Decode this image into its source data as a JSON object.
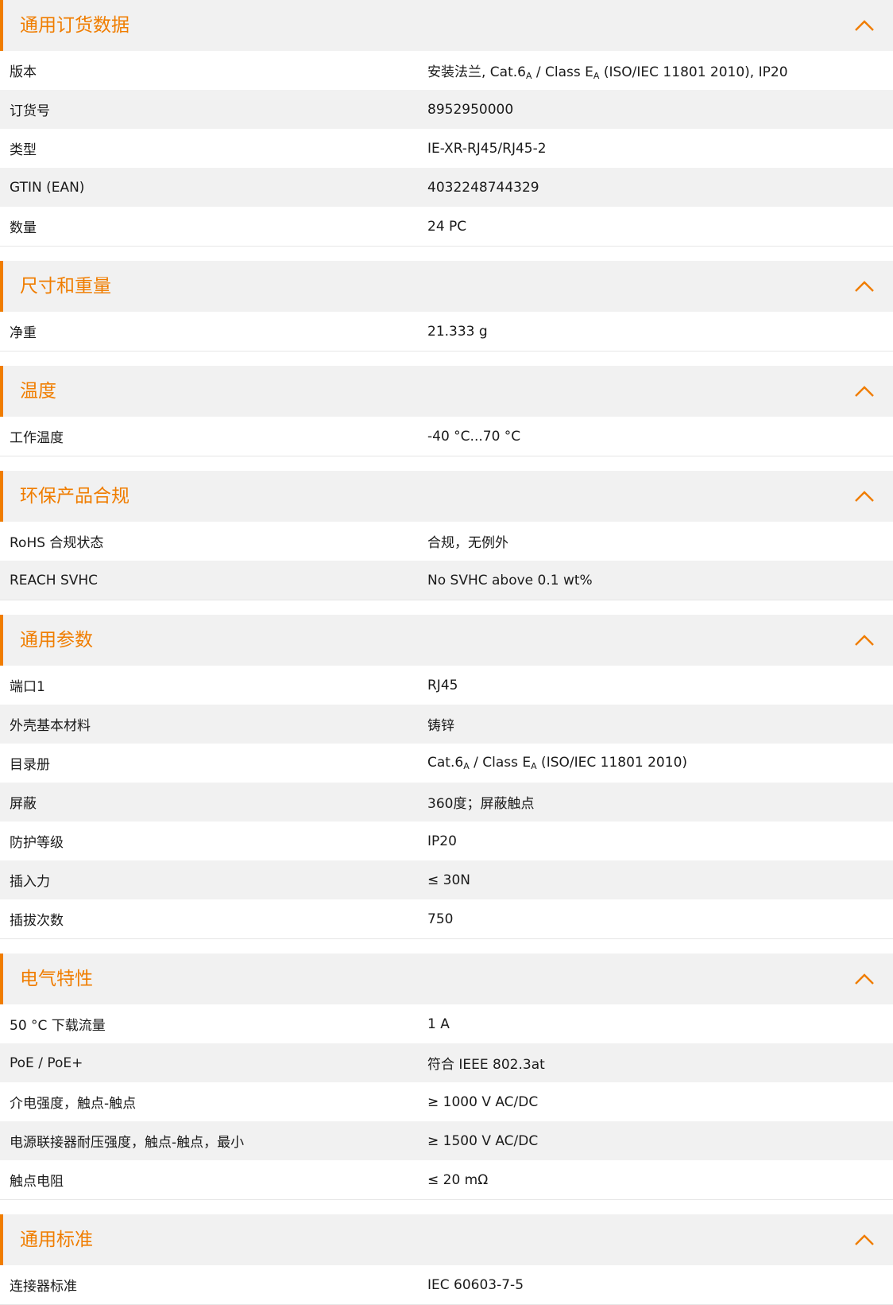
{
  "colors": {
    "accent": "#f07d00",
    "header_bg": "#f1f1f1",
    "stripe": "#f1f1f1"
  },
  "icons": {
    "collapse": "chevron-up-icon"
  },
  "sections": [
    {
      "id": "general-ordering",
      "title": "通用订货数据",
      "rows": [
        {
          "label": "版本",
          "value": {
            "a": "安装法兰, Cat.6",
            "sub1": "A",
            "b": " / Class E",
            "sub2": "A",
            "c": " (ISO/IEC 11801 2010), IP20"
          }
        },
        {
          "label": "订货号",
          "value": "8952950000"
        },
        {
          "label": "类型",
          "value": "IE-XR-RJ45/RJ45-2"
        },
        {
          "label": "GTIN (EAN)",
          "value": "4032248744329"
        },
        {
          "label": "数量",
          "value": "24  PC"
        }
      ]
    },
    {
      "id": "dimensions-weight",
      "title": "尺寸和重量",
      "rows": [
        {
          "label": "净重",
          "value": "21.333  g"
        }
      ]
    },
    {
      "id": "temperature",
      "title": "温度",
      "rows": [
        {
          "label": "工作温度",
          "value": "-40 °C...70 °C"
        }
      ]
    },
    {
      "id": "environmental-compliance",
      "title": "环保产品合规",
      "rows": [
        {
          "label": "RoHS 合规状态",
          "value": "合规，无例外"
        },
        {
          "label": "REACH SVHC",
          "value": "No SVHC above 0.1 wt%"
        }
      ]
    },
    {
      "id": "general-parameters",
      "title": "通用参数",
      "rows": [
        {
          "label": "端口1",
          "value": "RJ45"
        },
        {
          "label": "外壳基本材料",
          "value": "铸锌"
        },
        {
          "label": "目录册",
          "value": {
            "a": "Cat.6",
            "sub1": "A",
            "b": " / Class E",
            "sub2": "A",
            "c": " (ISO/IEC 11801 2010)"
          }
        },
        {
          "label": "屏蔽",
          "value": "360度；屏蔽触点"
        },
        {
          "label": "防护等级",
          "value": "IP20"
        },
        {
          "label": "插入力",
          "value": "≤ 30N"
        },
        {
          "label": "插拔次数",
          "value": "750"
        }
      ]
    },
    {
      "id": "electrical-characteristics",
      "title": "电气特性",
      "rows": [
        {
          "label": "50 °C 下载流量",
          "value": "1  A"
        },
        {
          "label": "PoE / PoE+",
          "value": "符合 IEEE 802.3at"
        },
        {
          "label": "介电强度，触点-触点",
          "value": "≥ 1000 V AC/DC"
        },
        {
          "label": "电源联接器耐压强度，触点-触点，最小",
          "value": "≥ 1500 V AC/DC"
        },
        {
          "label": "触点电阻",
          "value": "≤ 20 mΩ"
        }
      ]
    },
    {
      "id": "general-standards",
      "title": "通用标准",
      "rows": [
        {
          "label": "连接器标准",
          "value": "IEC 60603-7-5"
        }
      ]
    }
  ]
}
